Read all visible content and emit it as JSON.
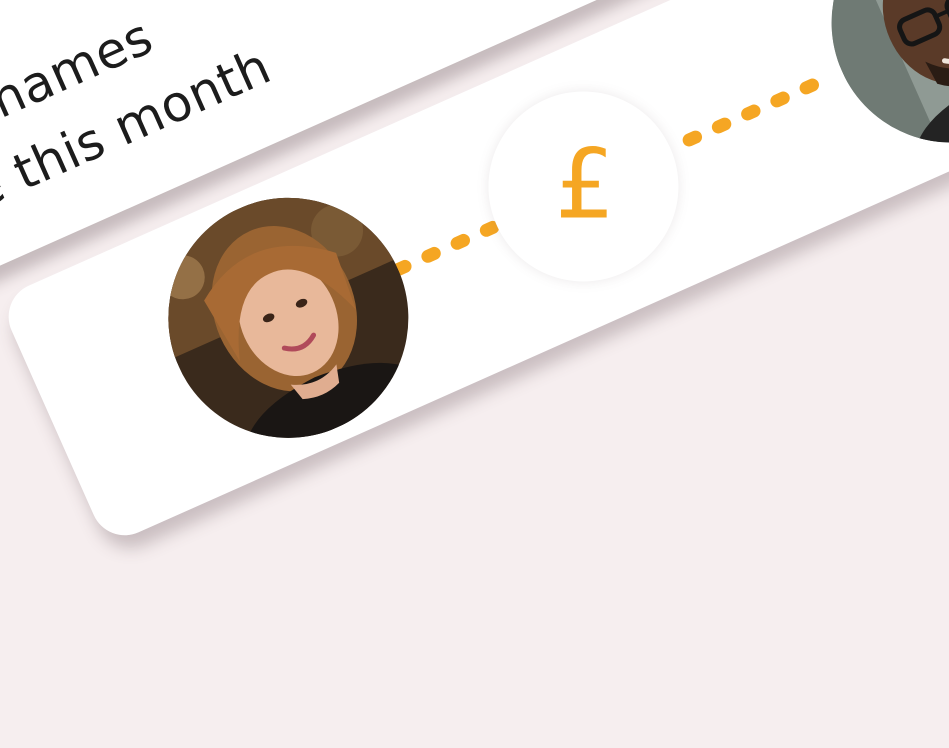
{
  "message": {
    "line1": "Your Thames",
    "line2": "more this month"
  },
  "transfer": {
    "currency_symbol": "£",
    "connector_color": "#f5a623"
  },
  "people": {
    "sender": {
      "avatar_icon": "woman-avatar-photo"
    },
    "recipient": {
      "avatar_icon": "man-avatar-photo"
    }
  },
  "colors": {
    "background": "#f6eeef",
    "card": "#ffffff",
    "accent": "#f5a623"
  }
}
